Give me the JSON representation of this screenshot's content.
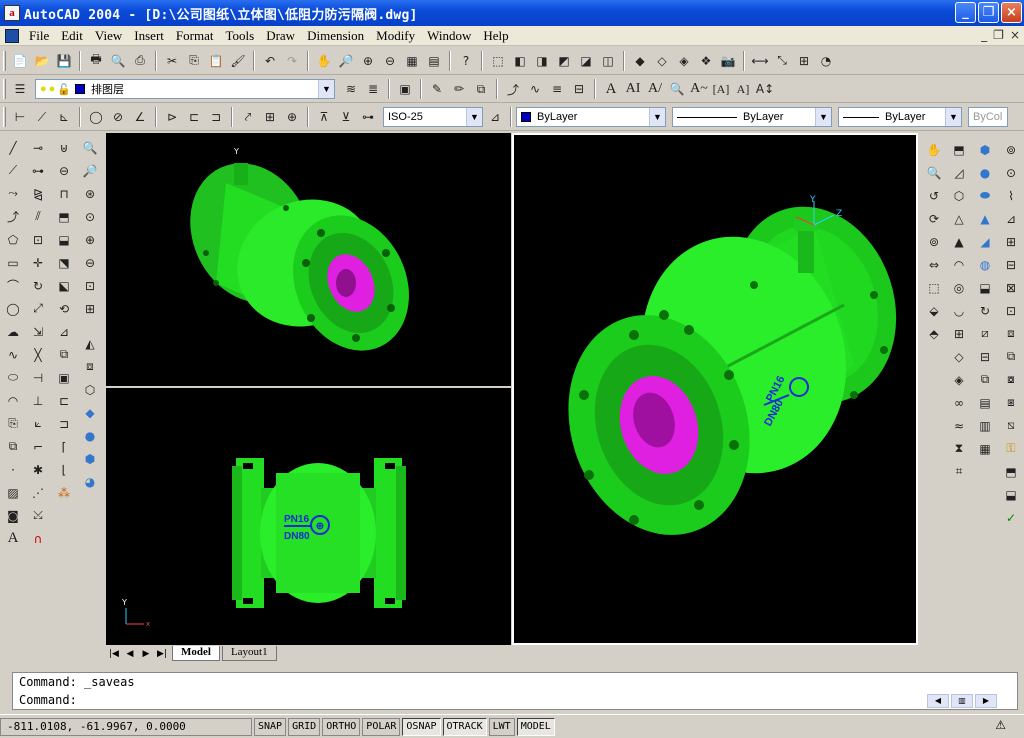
{
  "window": {
    "title": "AutoCAD 2004 - [D:\\公司图纸\\立体图\\低阻力防污隔阀.dwg]",
    "app_icon_letter": "a",
    "minimize": "_",
    "restore": "❐",
    "close": "×"
  },
  "menu": {
    "items": [
      "File",
      "Edit",
      "View",
      "Insert",
      "Format",
      "Tools",
      "Draw",
      "Dimension",
      "Modify",
      "Window",
      "Help"
    ],
    "doc_min": "_",
    "doc_restore": "❐",
    "doc_close": "×"
  },
  "layers": {
    "current_layer": "排图层"
  },
  "dimstyle": {
    "current": "ISO-25"
  },
  "properties": {
    "color": "ByLayer",
    "linetype": "ByLayer",
    "lineweight": "ByLayer",
    "plotstyle": "ByCol"
  },
  "viewports": {
    "label_pressure": "PN16",
    "label_size": "DN80",
    "ucs_x": "X",
    "ucs_y": "Y",
    "ucs_z": "Z"
  },
  "tabs": {
    "model": "Model",
    "layout1": "Layout1"
  },
  "command": {
    "line1": "Command: _saveas",
    "line2": "Command:"
  },
  "status": {
    "coords": "-811.0108, -61.9967, 0.0000",
    "toggles": [
      "SNAP",
      "GRID",
      "ORTHO",
      "POLAR",
      "OSNAP",
      "OTRACK",
      "LWT",
      "MODEL"
    ],
    "active_toggles": [
      "OSNAP",
      "OTRACK",
      "MODEL"
    ]
  },
  "colors": {
    "valve_green": "#22dd22",
    "valve_magenta": "#e020e0",
    "label_blue": "#1a2ad8",
    "title_blue": "#0a4bd8"
  }
}
